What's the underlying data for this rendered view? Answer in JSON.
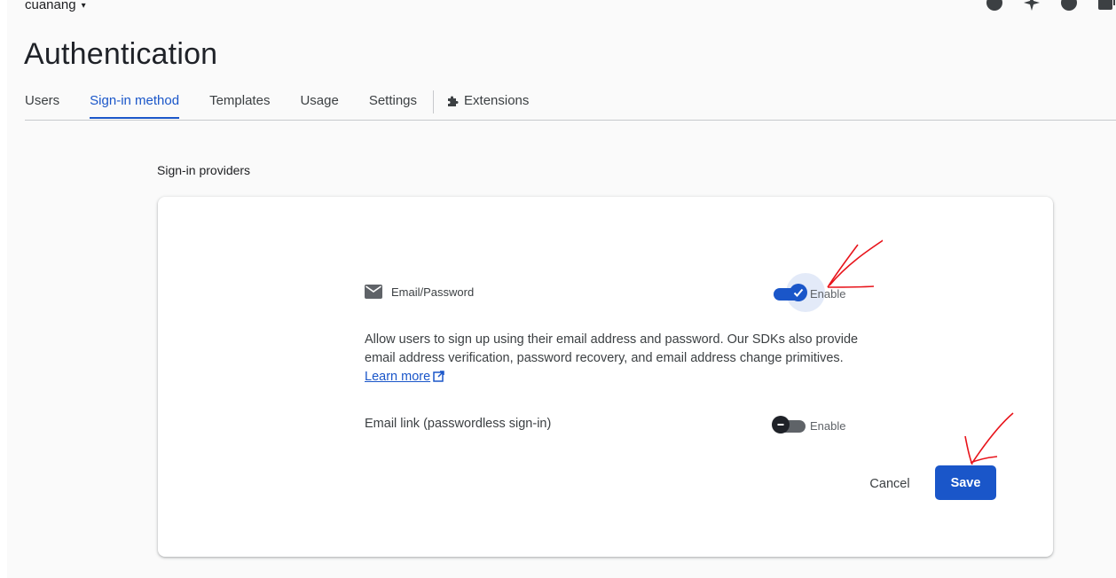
{
  "header": {
    "project_name": "cuanang",
    "project_caret": "▾",
    "icons": [
      "account-circle-icon",
      "sparkle-icon",
      "help-icon",
      "external-icon"
    ]
  },
  "page": {
    "title": "Authentication"
  },
  "tabs": [
    {
      "label": "Users",
      "active": false
    },
    {
      "label": "Sign-in method",
      "active": true
    },
    {
      "label": "Templates",
      "active": false
    },
    {
      "label": "Usage",
      "active": false
    },
    {
      "label": "Settings",
      "active": false
    }
  ],
  "extensions_tab": {
    "label": "Extensions",
    "icon": "puzzle-icon"
  },
  "providers": {
    "section_label": "Sign-in providers",
    "email_password": {
      "name": "Email/Password",
      "icon": "mail-icon",
      "enabled": true,
      "enable_label": "Enable"
    },
    "description": {
      "text": "Allow users to sign up using their email address and password. Our SDKs also provide email address verification, password recovery, and email address change primitives.",
      "link_text": "Learn more"
    },
    "email_link": {
      "label": "Email link (passwordless sign-in)",
      "enabled": false,
      "enable_label": "Enable"
    }
  },
  "actions": {
    "cancel_label": "Cancel",
    "save_label": "Save"
  },
  "colors": {
    "accent": "#1a56c9",
    "annotation": "#e8141b"
  }
}
